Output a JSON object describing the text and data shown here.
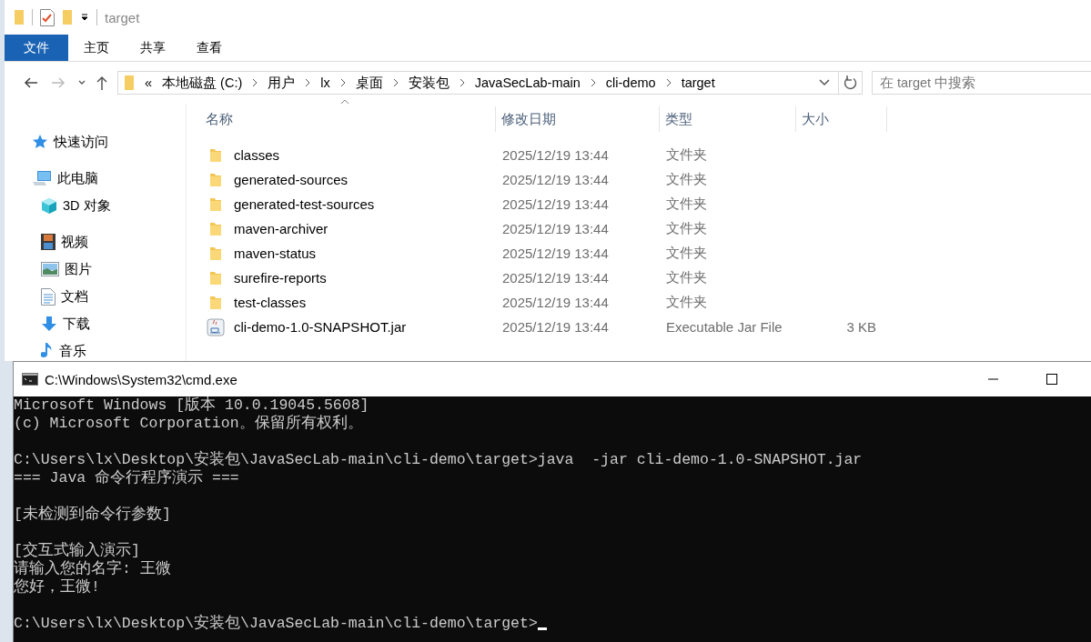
{
  "explorer": {
    "title": "target",
    "ribbon_tabs": [
      {
        "label": "文件",
        "kind": "file"
      },
      {
        "label": "主页",
        "kind": "tab"
      },
      {
        "label": "共享",
        "kind": "tab"
      },
      {
        "label": "查看",
        "kind": "tab"
      }
    ],
    "address": {
      "overflow": "«",
      "crumbs": [
        "本地磁盘 (C:)",
        "用户",
        "lx",
        "桌面",
        "安装包",
        "JavaSecLab-main",
        "cli-demo",
        "target"
      ]
    },
    "search": {
      "placeholder": "在 target 中搜索"
    },
    "sidebar": {
      "items": [
        {
          "label": "快速访问",
          "kind": "star"
        },
        {
          "label": "此电脑",
          "kind": "computer",
          "children": [
            {
              "label": "3D 对象",
              "kind": "cube"
            },
            {
              "label": "视频",
              "kind": "video"
            },
            {
              "label": "图片",
              "kind": "image"
            },
            {
              "label": "文档",
              "kind": "document"
            },
            {
              "label": "下载",
              "kind": "download"
            },
            {
              "label": "音乐",
              "kind": "music"
            }
          ]
        }
      ]
    },
    "table": {
      "columns": [
        "名称",
        "修改日期",
        "类型",
        "大小"
      ],
      "rows": [
        {
          "kind": "folder",
          "name": "classes",
          "date": "2025/12/19 13:44",
          "type": "文件夹"
        },
        {
          "kind": "folder",
          "name": "generated-sources",
          "date": "2025/12/19 13:44",
          "type": "文件夹"
        },
        {
          "kind": "folder",
          "name": "generated-test-sources",
          "date": "2025/12/19 13:44",
          "type": "文件夹"
        },
        {
          "kind": "folder",
          "name": "maven-archiver",
          "date": "2025/12/19 13:44",
          "type": "文件夹"
        },
        {
          "kind": "folder",
          "name": "maven-status",
          "date": "2025/12/19 13:44",
          "type": "文件夹"
        },
        {
          "kind": "folder",
          "name": "surefire-reports",
          "date": "2025/12/19 13:44",
          "type": "文件夹"
        },
        {
          "kind": "folder",
          "name": "test-classes",
          "date": "2025/12/19 13:44",
          "type": "文件夹"
        },
        {
          "kind": "jar",
          "name": "cli-demo-1.0-SNAPSHOT.jar",
          "date": "2025/12/19 13:44",
          "type": "Executable Jar File",
          "size": "3 KB"
        }
      ]
    }
  },
  "console": {
    "title": "C:\\Windows\\System32\\cmd.exe",
    "lines": [
      {
        "kind": "text",
        "text": "Microsoft Windows [版本 10.0.19045.5608]"
      },
      {
        "kind": "text",
        "text": "(c) Microsoft Corporation。保留所有权利。"
      },
      {
        "kind": "blank"
      },
      {
        "kind": "text",
        "text": "C:\\Users\\lx\\Desktop\\安装包\\JavaSecLab-main\\cli-demo\\target>java  -jar cli-demo-1.0-SNAPSHOT.jar"
      },
      {
        "kind": "text",
        "text": "=== Java 命令行程序演示 ==="
      },
      {
        "kind": "blank"
      },
      {
        "kind": "text",
        "text": "[未检测到命令行参数]"
      },
      {
        "kind": "blank"
      },
      {
        "kind": "text",
        "text": "[交互式输入演示]"
      },
      {
        "kind": "text",
        "text": "请输入您的名字: 王微"
      },
      {
        "kind": "text",
        "text": "您好，王微!"
      },
      {
        "kind": "blank"
      },
      {
        "kind": "prompt",
        "text": "C:\\Users\\lx\\Desktop\\安装包\\JavaSecLab-main\\cli-demo\\target>"
      }
    ]
  }
}
